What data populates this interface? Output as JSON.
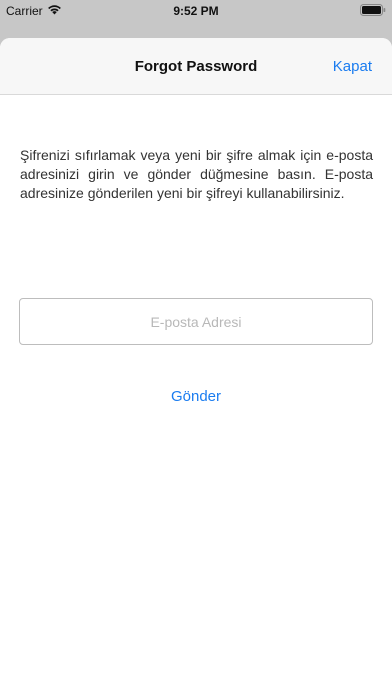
{
  "status_bar": {
    "carrier": "Carrier",
    "time": "9:52 PM",
    "icons": [
      "wifi-icon",
      "battery-icon"
    ]
  },
  "nav": {
    "title": "Forgot Password",
    "close_label": "Kapat"
  },
  "main": {
    "description": "Şifrenizi sıfırlamak veya yeni bir şifre almak için e-posta adresinizi girin ve gönder düğmesine basın. E-posta adresinize gönderilen yeni bir şifreyi kullanabilirsiniz.",
    "email_value": "",
    "email_placeholder": "E-posta Adresi",
    "submit_label": "Gönder"
  },
  "colors": {
    "accent": "#1a7cf0",
    "backdrop": "#c7c7c7",
    "nav_background": "#f7f7f7"
  }
}
